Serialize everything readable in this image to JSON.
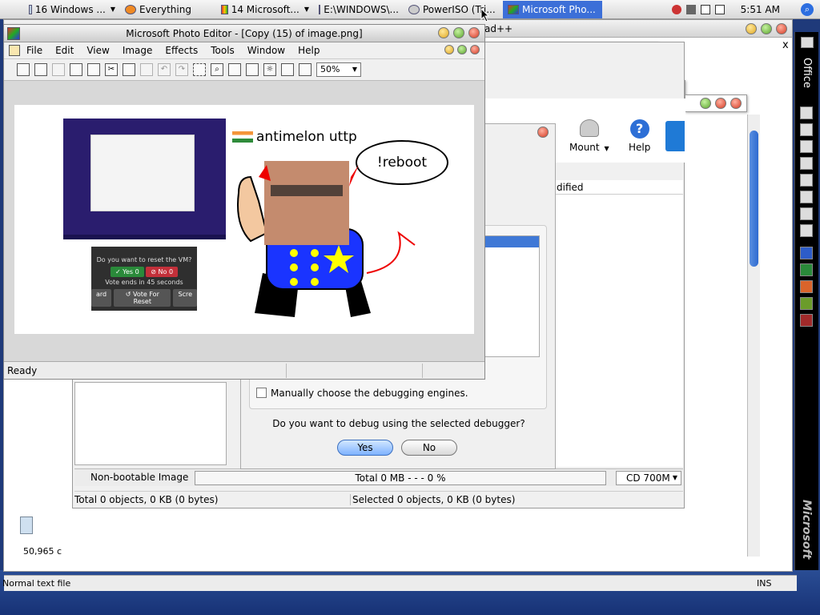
{
  "menubar": {
    "items": [
      {
        "label": "16 Windows ...",
        "dropdown": true
      },
      {
        "label": "Everything",
        "dropdown": false
      },
      {
        "label": "14 Microsoft...",
        "dropdown": true
      },
      {
        "label": "E:\\WINDOWS\\...",
        "dropdown": false
      },
      {
        "label": "PowerISO (Tri...",
        "dropdown": false
      },
      {
        "label": "Microsoft Pho...",
        "dropdown": false,
        "active": true
      }
    ],
    "clock": "5:51 AM"
  },
  "notepad": {
    "title_suffix": "ad++",
    "status_left": "50,965 c",
    "status_text": "Normal text file",
    "status_ins": "INS"
  },
  "office_bar": {
    "label": "Office",
    "brand": "Microsoft"
  },
  "poweriso": {
    "toolbar": {
      "mount": "Mount",
      "help": "Help"
    },
    "column_header": "dified",
    "status_type": "Non-bootable Image",
    "progress_text": "Total  0 MB   - - -  0 %",
    "media_select": "CD 700M",
    "footer_left": "Total 0 objects, 0 KB (0 bytes)",
    "footer_right": "Selected 0 objects, 0 KB (0 bytes)"
  },
  "debugger": {
    "checkbox_label": "Manually choose the debugging engines.",
    "question": "Do you want to debug using the selected debugger?",
    "yes": "Yes",
    "no": "No"
  },
  "photo_editor": {
    "title": "Microsoft Photo Editor - [Copy (15) of image.png]",
    "menu": [
      "File",
      "Edit",
      "View",
      "Image",
      "Effects",
      "Tools",
      "Window",
      "Help"
    ],
    "zoom": "50%",
    "status": "Ready",
    "image": {
      "caption": "antimelon uttp",
      "bubble": "!reboot",
      "vote_question": "Do you want to reset the VM?",
      "vote_yes": "✓ Yes 0",
      "vote_no": "⊘ No 0",
      "vote_ends": "Vote ends in 45 seconds",
      "vote_reset": "↺ Vote For Reset",
      "vote_left": "ard",
      "vote_right": "Scre"
    }
  },
  "colors": {
    "accent": "#3c6fd8",
    "desktop": "#1f3a7a"
  }
}
